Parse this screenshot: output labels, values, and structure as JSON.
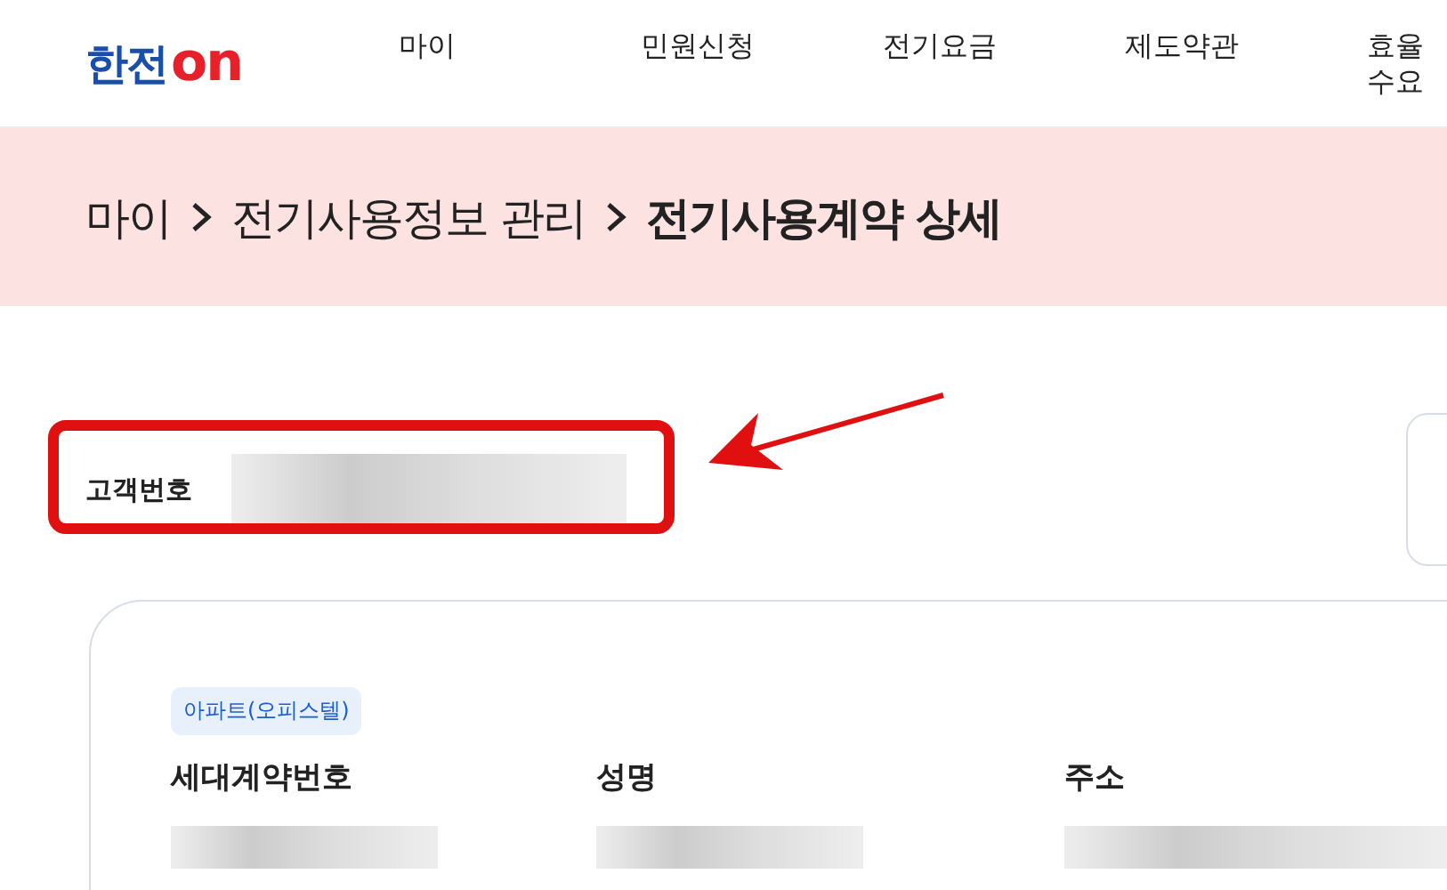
{
  "logo": {
    "text": "한전",
    "suffix": "on"
  },
  "nav": [
    {
      "label": "마이"
    },
    {
      "label": "민원신청"
    },
    {
      "label": "전기요금"
    },
    {
      "label": "제도약관"
    },
    {
      "label": "효율\n수요"
    }
  ],
  "breadcrumb": [
    {
      "label": "마이",
      "current": false
    },
    {
      "label": "전기사용정보 관리",
      "current": false
    },
    {
      "label": "전기사용계약 상세",
      "current": true
    }
  ],
  "customer": {
    "label": "고객번호"
  },
  "contract_card": {
    "badge": "아파트(오피스텔)",
    "columns": [
      {
        "label": "세대계약번호"
      },
      {
        "label": "성명"
      },
      {
        "label": "주소"
      }
    ]
  }
}
